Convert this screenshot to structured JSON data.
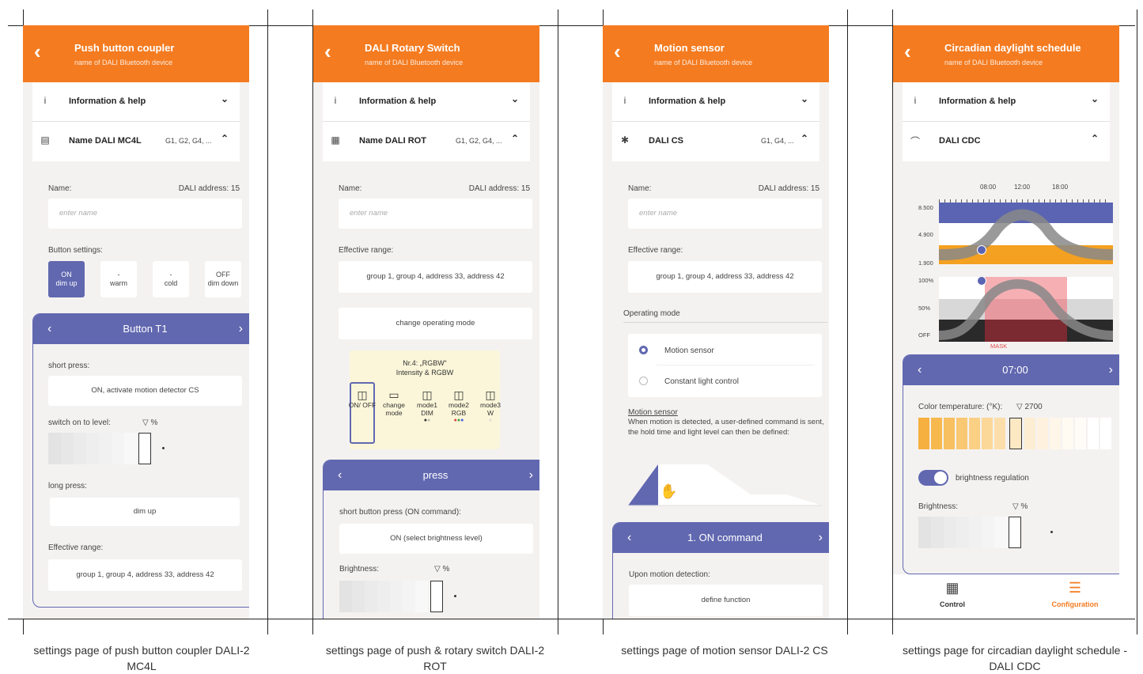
{
  "panels": [
    {
      "title": "Push button coupler",
      "subtitle": "name of DALI Bluetooth device",
      "info_label": "Information & help",
      "device_name": "Name DALI MC4L",
      "groups": "G1, G2, G4, ...",
      "name_label": "Name:",
      "address_label": "DALI address: 15",
      "name_placeholder": "enter name",
      "button_settings_label": "Button settings:",
      "buttons": [
        {
          "line1": "ON",
          "line2": "dim up"
        },
        {
          "line1": "-",
          "line2": "warm"
        },
        {
          "line1": "-",
          "line2": "cold"
        },
        {
          "line1": "OFF",
          "line2": "dim down"
        }
      ],
      "card_title": "Button T1",
      "short_press_label": "short press:",
      "short_press_value": "ON, activate motion detector CS",
      "switch_on_label": "switch on to level:",
      "level_unit": "▽  %",
      "long_press_label": "long press:",
      "long_press_value": "dim up",
      "range_label": "Effective range:",
      "range_value": "group 1, group 4, address 33, address 42",
      "caption": "settings page of push button coupler DALI-2 MC4L"
    },
    {
      "title": "DALI Rotary Switch",
      "subtitle": "name of DALI Bluetooth device",
      "info_label": "Information & help",
      "device_name": "Name DALI ROT",
      "groups": "G1, G2, G4, ...",
      "name_label": "Name:",
      "address_label": "DALI address: 15",
      "name_placeholder": "enter name",
      "range_label": "Effective range:",
      "range_value": "group 1, group 4, address 33, address 42",
      "change_mode": "change operating mode",
      "mode_title": "Nr.4: „RGBW“",
      "mode_sub": "Intensity & RGBW",
      "modes": [
        "ON/ OFF",
        "change mode",
        "mode1 DIM",
        "mode2 RGB",
        "mode3 W"
      ],
      "card_title": "press",
      "short_press_label": "short button press (ON command):",
      "short_press_value": "ON (select brightness level)",
      "brightness_label": "Brightness:",
      "level_unit": "▽  %",
      "caption": "settings page of push & rotary switch DALI-2 ROT"
    },
    {
      "title": "Motion sensor",
      "subtitle": "name of DALI Bluetooth device",
      "info_label": "Information & help",
      "device_name": "DALI CS",
      "groups": "G1, G4, ...",
      "name_label": "Name:",
      "address_label": "DALI address: 15",
      "name_placeholder": "enter name",
      "range_label": "Effective range:",
      "range_value": "group 1, group 4, address 33, address 42",
      "operating_mode_label": "Operating mode",
      "options": [
        "Motion sensor",
        "Constant light control"
      ],
      "desc_title": "Motion sensor",
      "desc_text": "When motion is detected, a user-defined command is sent, the hold time and light level can then be defined:",
      "card_title": "1. ON command",
      "upon_label": "Upon motion detection:",
      "define_function": "define function",
      "caption": "settings page of motion sensor DALI-2 CS"
    },
    {
      "title": "Circadian daylight schedule",
      "subtitle": "name of DALI Bluetooth device",
      "info_label": "Information & help",
      "device_name": "DALI CDC",
      "time_ticks": [
        "08:00",
        "12:00",
        "18:00"
      ],
      "color_axis": [
        "8.500",
        "4.900",
        "1.900"
      ],
      "bright_axis": [
        "100%",
        "50%",
        "OFF"
      ],
      "mask_label": "MASK",
      "card_title": "07:00",
      "color_temp_label": "Color temperature: (°K):",
      "color_temp_value": "▽  2700",
      "toggle_label": "brightness regulation",
      "brightness_label": "Brightness:",
      "level_unit": "▽  %",
      "nav_control": "Control",
      "nav_config": "Configuration",
      "caption": "settings page for circadian daylight schedule - DALI CDC"
    }
  ],
  "colors": {
    "orange": "#f47b20",
    "indigo": "#6168b0",
    "background": "#f4f2f1"
  }
}
